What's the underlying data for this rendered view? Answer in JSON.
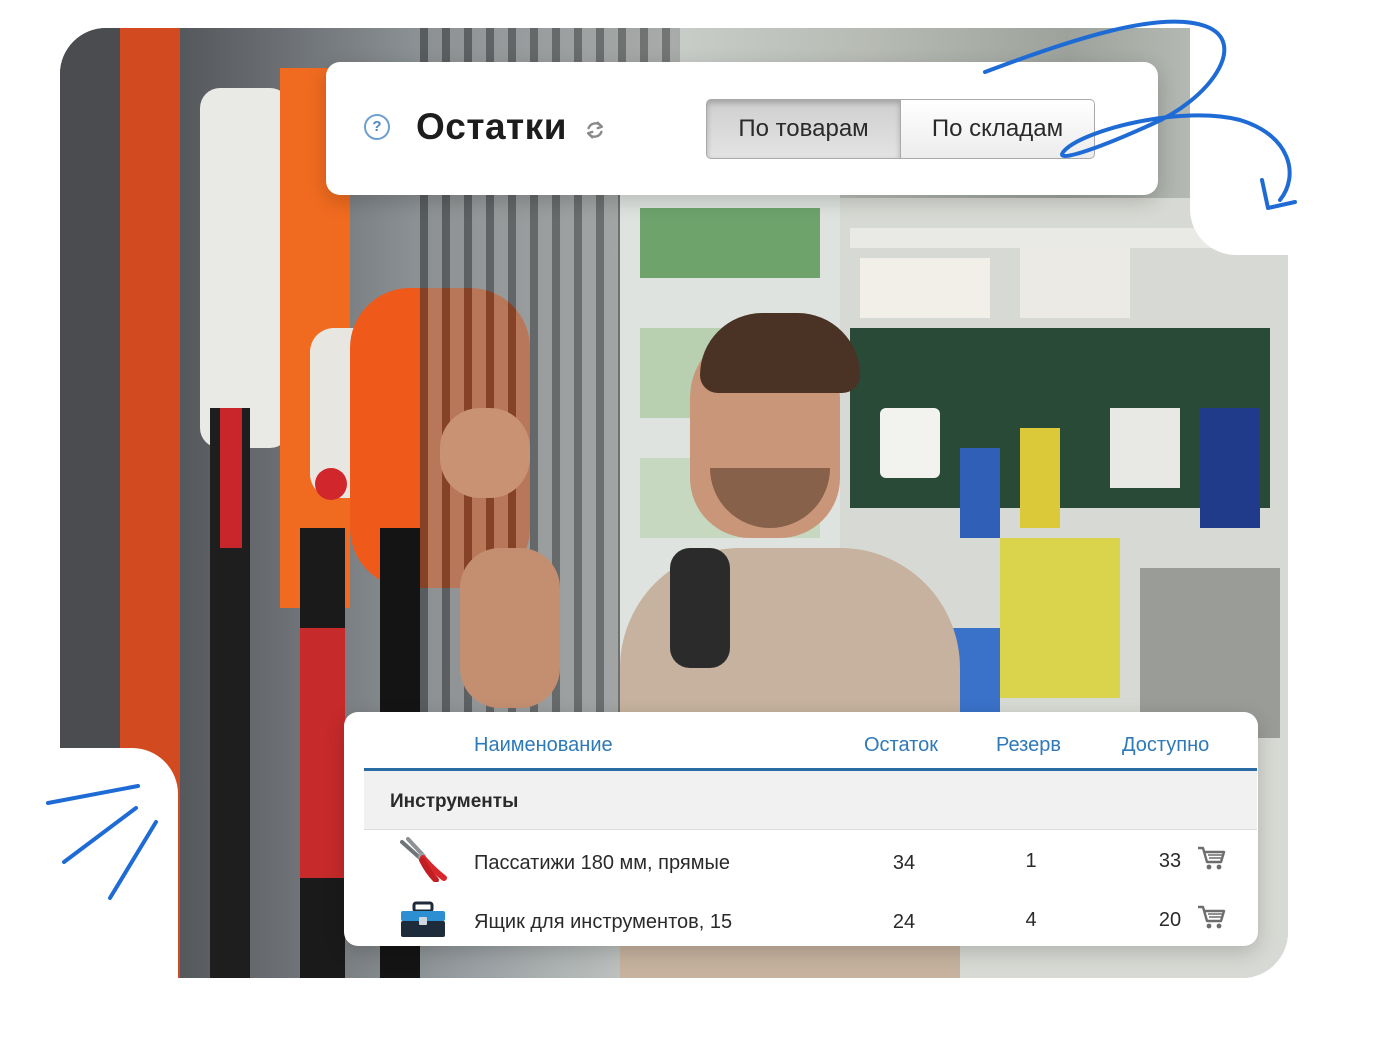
{
  "header": {
    "title": "Остатки",
    "help_icon": "question-icon",
    "refresh_icon": "refresh-icon",
    "tabs": [
      {
        "label": "По товарам",
        "active": true
      },
      {
        "label": "По складам",
        "active": false
      }
    ]
  },
  "table": {
    "columns": {
      "name": "Наименование",
      "stock": "Остаток",
      "reserve": "Резерв",
      "available": "Доступно"
    },
    "group": "Инструменты",
    "rows": [
      {
        "icon": "pliers-icon",
        "name": "Пассатижи 180 мм, прямые",
        "stock": "34",
        "reserve": "1",
        "available": "33",
        "action_icon": "cart-icon"
      },
      {
        "icon": "toolbox-icon",
        "name": "Ящик для инструментов, 15",
        "stock": "24",
        "reserve": "4",
        "available": "20",
        "action_icon": "cart-icon"
      }
    ]
  },
  "colors": {
    "accent": "#2e79b7",
    "doodle": "#1f6bd6",
    "header_line": "#2a6aa5"
  }
}
